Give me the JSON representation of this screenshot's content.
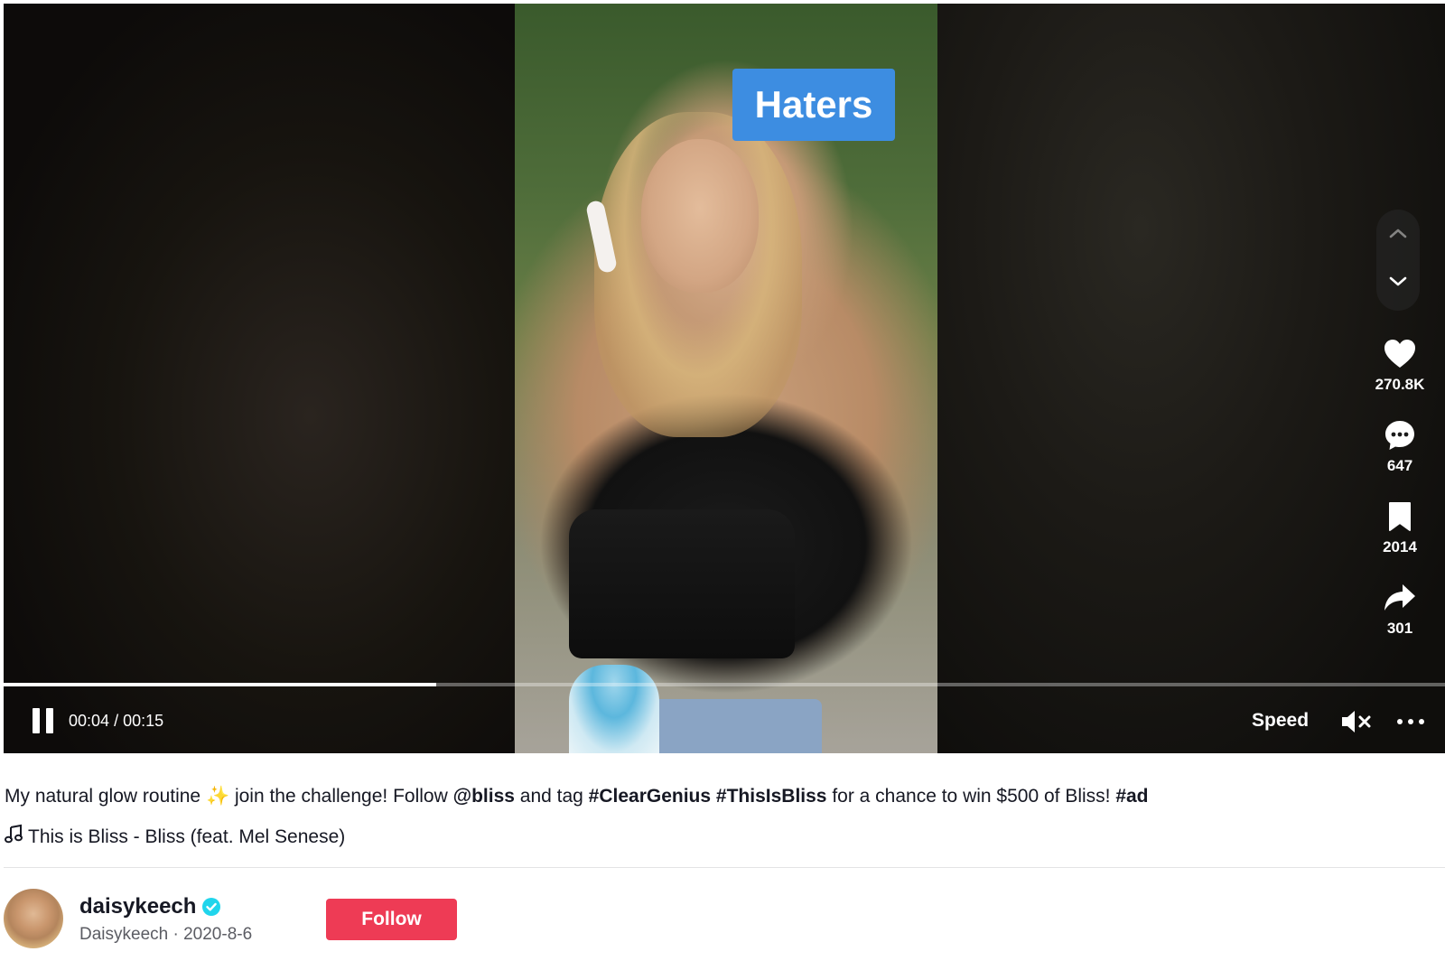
{
  "video": {
    "sticker_text": "Haters",
    "elapsed": "00:04",
    "duration": "00:15",
    "progress_fraction": 0.3,
    "speed_label": "Speed"
  },
  "actions": {
    "likes": "270.8K",
    "comments": "647",
    "saves": "2014",
    "shares": "301"
  },
  "post": {
    "caption_parts": {
      "p1": "My natural glow routine ",
      "sparkle": "✨",
      "p2": " join the challenge! Follow ",
      "mention": "@bliss",
      "p3": " and tag ",
      "tag1": "#ClearGenius",
      "sp": " ",
      "tag2": "#ThisIsBliss",
      "p4": " for a chance to win $500 of Bliss! ",
      "tag3": "#ad"
    },
    "music": "This is Bliss - Bliss (feat. Mel Senese)"
  },
  "author": {
    "username": "daisykeech",
    "nickname": "Daisykeech",
    "date": "2020-8-6",
    "separator": " · ",
    "follow_label": "Follow"
  },
  "colors": {
    "accent": "#ee3b55",
    "sticker": "#3d8de1",
    "verified": "#20d5ec"
  },
  "icons": [
    "pause-icon",
    "mute-icon",
    "more-icon",
    "chevron-up-icon",
    "chevron-down-icon",
    "heart-icon",
    "comment-icon",
    "bookmark-icon",
    "share-icon",
    "music-note-icon",
    "verified-icon"
  ]
}
